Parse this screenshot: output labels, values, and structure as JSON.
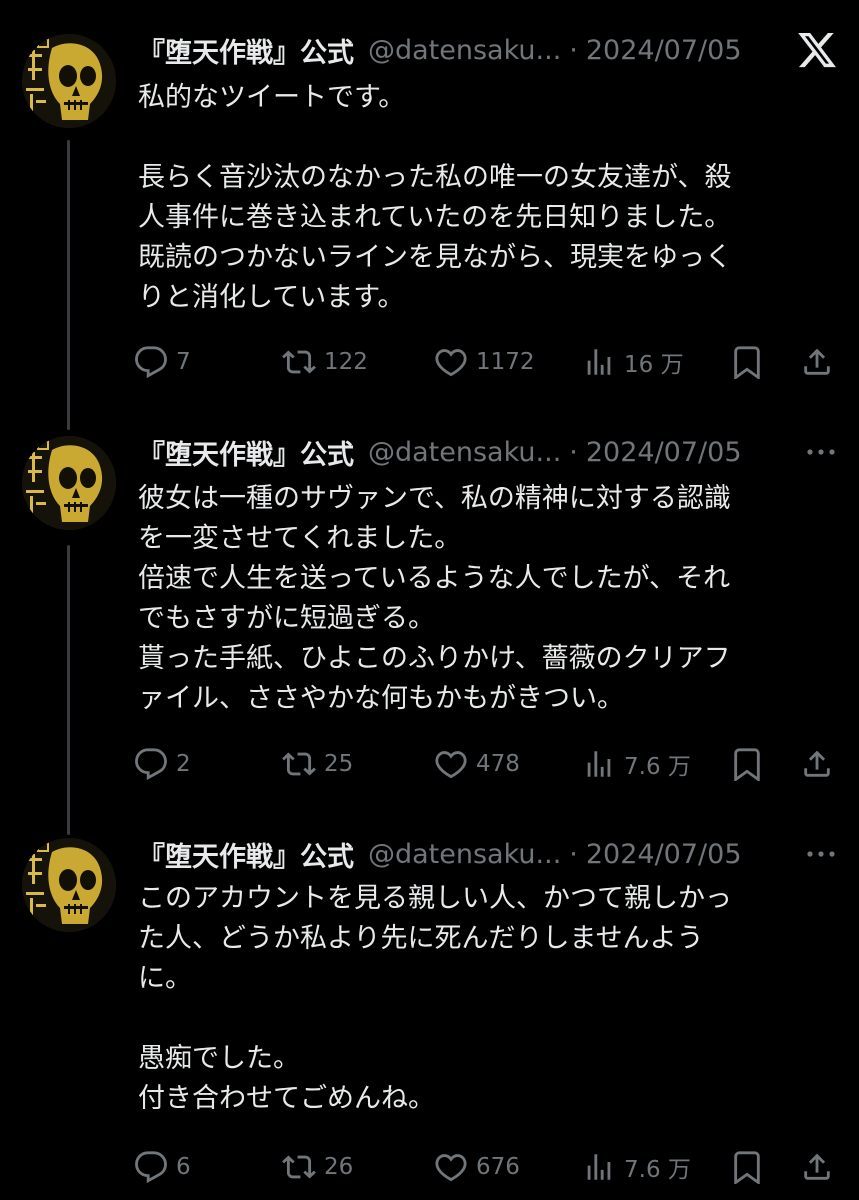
{
  "account": {
    "name": "『堕天作戦』公式",
    "handle": "@datensaku...",
    "separator": "·"
  },
  "tweets": [
    {
      "date": "2024/07/05",
      "paragraphs": [
        [
          "私的なツイートです。"
        ],
        [
          "長らく音沙汰のなかった私の唯一の女友達が、殺",
          "人事件に巻き込まれていたのを先日知りました。",
          "既読のつかないラインを見ながら、現実をゆっく",
          "りと消化しています。"
        ]
      ],
      "replies": "7",
      "retweets": "122",
      "likes": "1172",
      "views": "16 万"
    },
    {
      "date": "2024/07/05",
      "paragraphs": [
        [
          "彼女は一種のサヴァンで、私の精神に対する認識",
          "を一変させてくれました。",
          "倍速で人生を送っているような人でしたが、それ",
          "でもさすがに短過ぎる。",
          "貰った手紙、ひよこのふりかけ、薔薇のクリアフ",
          "ァイル、ささやかな何もかもがきつい。"
        ]
      ],
      "replies": "2",
      "retweets": "25",
      "likes": "478",
      "views": "7.6 万"
    },
    {
      "date": "2024/07/05",
      "paragraphs": [
        [
          "このアカウントを見る親しい人、かつて親しかっ",
          "た人、どうか私より先に死んだりしませんよう",
          "に。"
        ],
        [
          "愚痴でした。",
          "付き合わせてごめんね。"
        ]
      ],
      "replies": "6",
      "retweets": "26",
      "likes": "676",
      "views": "7.6 万"
    }
  ],
  "icons": {
    "corner": "x-logo-icon",
    "more": "more-dots-icon",
    "reply": "reply-icon",
    "retweet": "retweet-icon",
    "like": "heart-icon",
    "views": "views-chart-icon",
    "bookmark": "bookmark-icon",
    "share": "share-icon"
  },
  "colors": {
    "background": "#000000",
    "text": "#e7e9ea",
    "muted": "#71767b",
    "thread_line": "#3a3d40"
  }
}
